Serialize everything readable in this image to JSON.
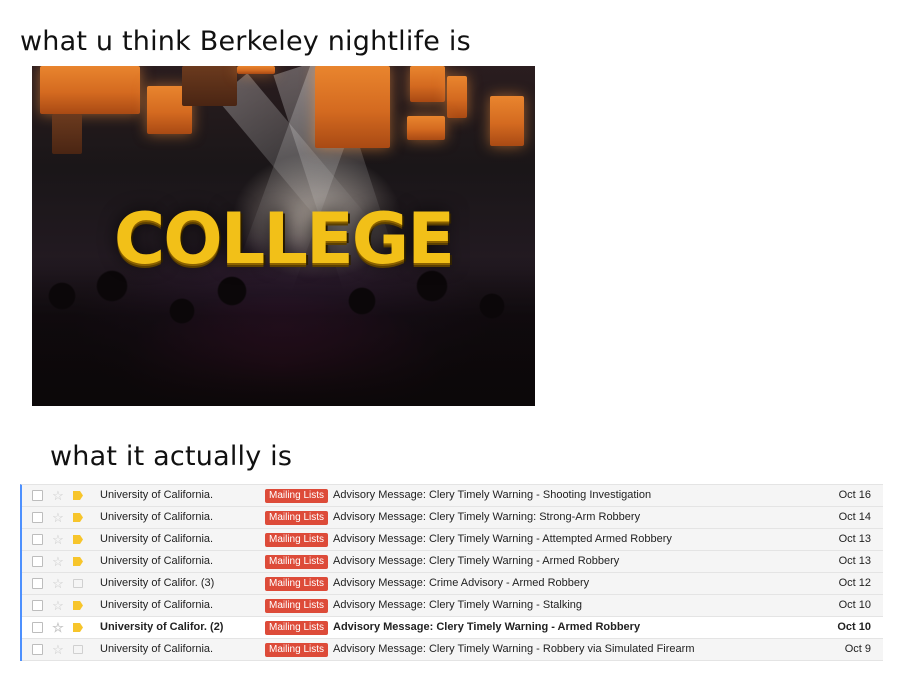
{
  "captions": {
    "top": "what u think Berkeley nightlife is",
    "bottom": "what it actually is"
  },
  "promo_image": {
    "logo_text": "COLLEGE",
    "logo_color": "#f2c018"
  },
  "inbox": {
    "label_color": "#dd4b39",
    "rows": [
      {
        "sender": "University of California.",
        "label": "Mailing Lists",
        "subject": "Advisory Message: Clery Timely Warning - Shooting Investigation",
        "date": "Oct 16",
        "unread": false,
        "tag": true
      },
      {
        "sender": "University of California.",
        "label": "Mailing Lists",
        "subject": "Advisory Message: Clery Timely Warning: Strong-Arm Robbery",
        "date": "Oct 14",
        "unread": false,
        "tag": true
      },
      {
        "sender": "University of California.",
        "label": "Mailing Lists",
        "subject": "Advisory Message: Clery Timely Warning - Attempted Armed Robbery",
        "date": "Oct 13",
        "unread": false,
        "tag": true
      },
      {
        "sender": "University of California.",
        "label": "Mailing Lists",
        "subject": "Advisory Message: Clery Timely Warning - Armed Robbery",
        "date": "Oct 13",
        "unread": false,
        "tag": true
      },
      {
        "sender": "University of Califor. (3)",
        "label": "Mailing Lists",
        "subject": "Advisory Message: Crime Advisory - Armed Robbery",
        "date": "Oct 12",
        "unread": false,
        "tag": false
      },
      {
        "sender": "University of California.",
        "label": "Mailing Lists",
        "subject": "Advisory Message: Clery Timely Warning - Stalking",
        "date": "Oct 10",
        "unread": false,
        "tag": true
      },
      {
        "sender": "University of Califor. (2)",
        "label": "Mailing Lists",
        "subject": "Advisory Message: Clery Timely Warning - Armed Robbery",
        "date": "Oct 10",
        "unread": true,
        "tag": true
      },
      {
        "sender": "University of California.",
        "label": "Mailing Lists",
        "subject": "Advisory Message: Clery Timely Warning - Robbery via Simulated Firearm",
        "date": "Oct 9",
        "unread": false,
        "tag": false
      }
    ]
  }
}
